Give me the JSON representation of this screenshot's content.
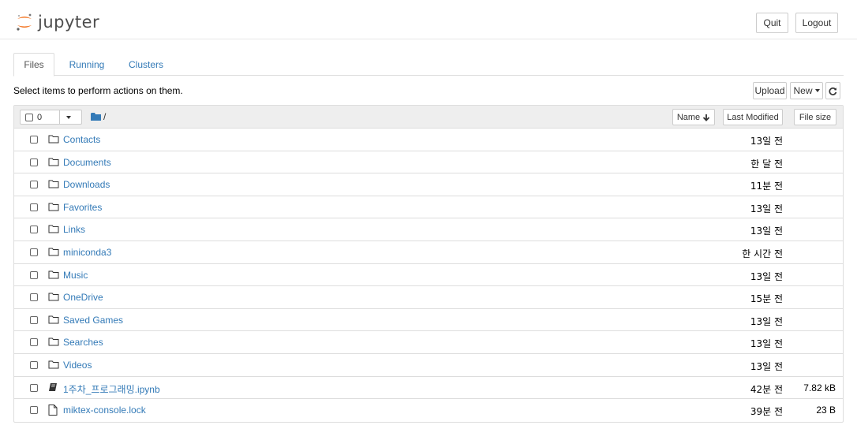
{
  "header": {
    "logo_text": "jupyter",
    "quit_label": "Quit",
    "logout_label": "Logout"
  },
  "tabs": [
    {
      "label": "Files",
      "active": true
    },
    {
      "label": "Running",
      "active": false
    },
    {
      "label": "Clusters",
      "active": false
    }
  ],
  "toolbar": {
    "instructions": "Select items to perform actions on them.",
    "upload_label": "Upload",
    "new_label": "New"
  },
  "list_header": {
    "selected_count": "0",
    "path": "/",
    "sort_name_label": "Name",
    "sort_modified_label": "Last Modified",
    "sort_size_label": "File size"
  },
  "files": [
    {
      "type": "folder",
      "name": "Contacts",
      "modified": "13일 전",
      "size": ""
    },
    {
      "type": "folder",
      "name": "Documents",
      "modified": "한 달 전",
      "size": ""
    },
    {
      "type": "folder",
      "name": "Downloads",
      "modified": "11분 전",
      "size": ""
    },
    {
      "type": "folder",
      "name": "Favorites",
      "modified": "13일 전",
      "size": ""
    },
    {
      "type": "folder",
      "name": "Links",
      "modified": "13일 전",
      "size": ""
    },
    {
      "type": "folder",
      "name": "miniconda3",
      "modified": "한 시간 전",
      "size": ""
    },
    {
      "type": "folder",
      "name": "Music",
      "modified": "13일 전",
      "size": ""
    },
    {
      "type": "folder",
      "name": "OneDrive",
      "modified": "15분 전",
      "size": ""
    },
    {
      "type": "folder",
      "name": "Saved Games",
      "modified": "13일 전",
      "size": ""
    },
    {
      "type": "folder",
      "name": "Searches",
      "modified": "13일 전",
      "size": ""
    },
    {
      "type": "folder",
      "name": "Videos",
      "modified": "13일 전",
      "size": ""
    },
    {
      "type": "notebook",
      "name": "1주차_프로그래밍.ipynb",
      "modified": "42분 전",
      "size": "7.82 kB"
    },
    {
      "type": "file",
      "name": "miktex-console.lock",
      "modified": "39분 전",
      "size": "23 B"
    }
  ],
  "colors": {
    "link": "#337ab7",
    "logo_orange": "#f37726",
    "header_bg": "#eeeeee"
  }
}
